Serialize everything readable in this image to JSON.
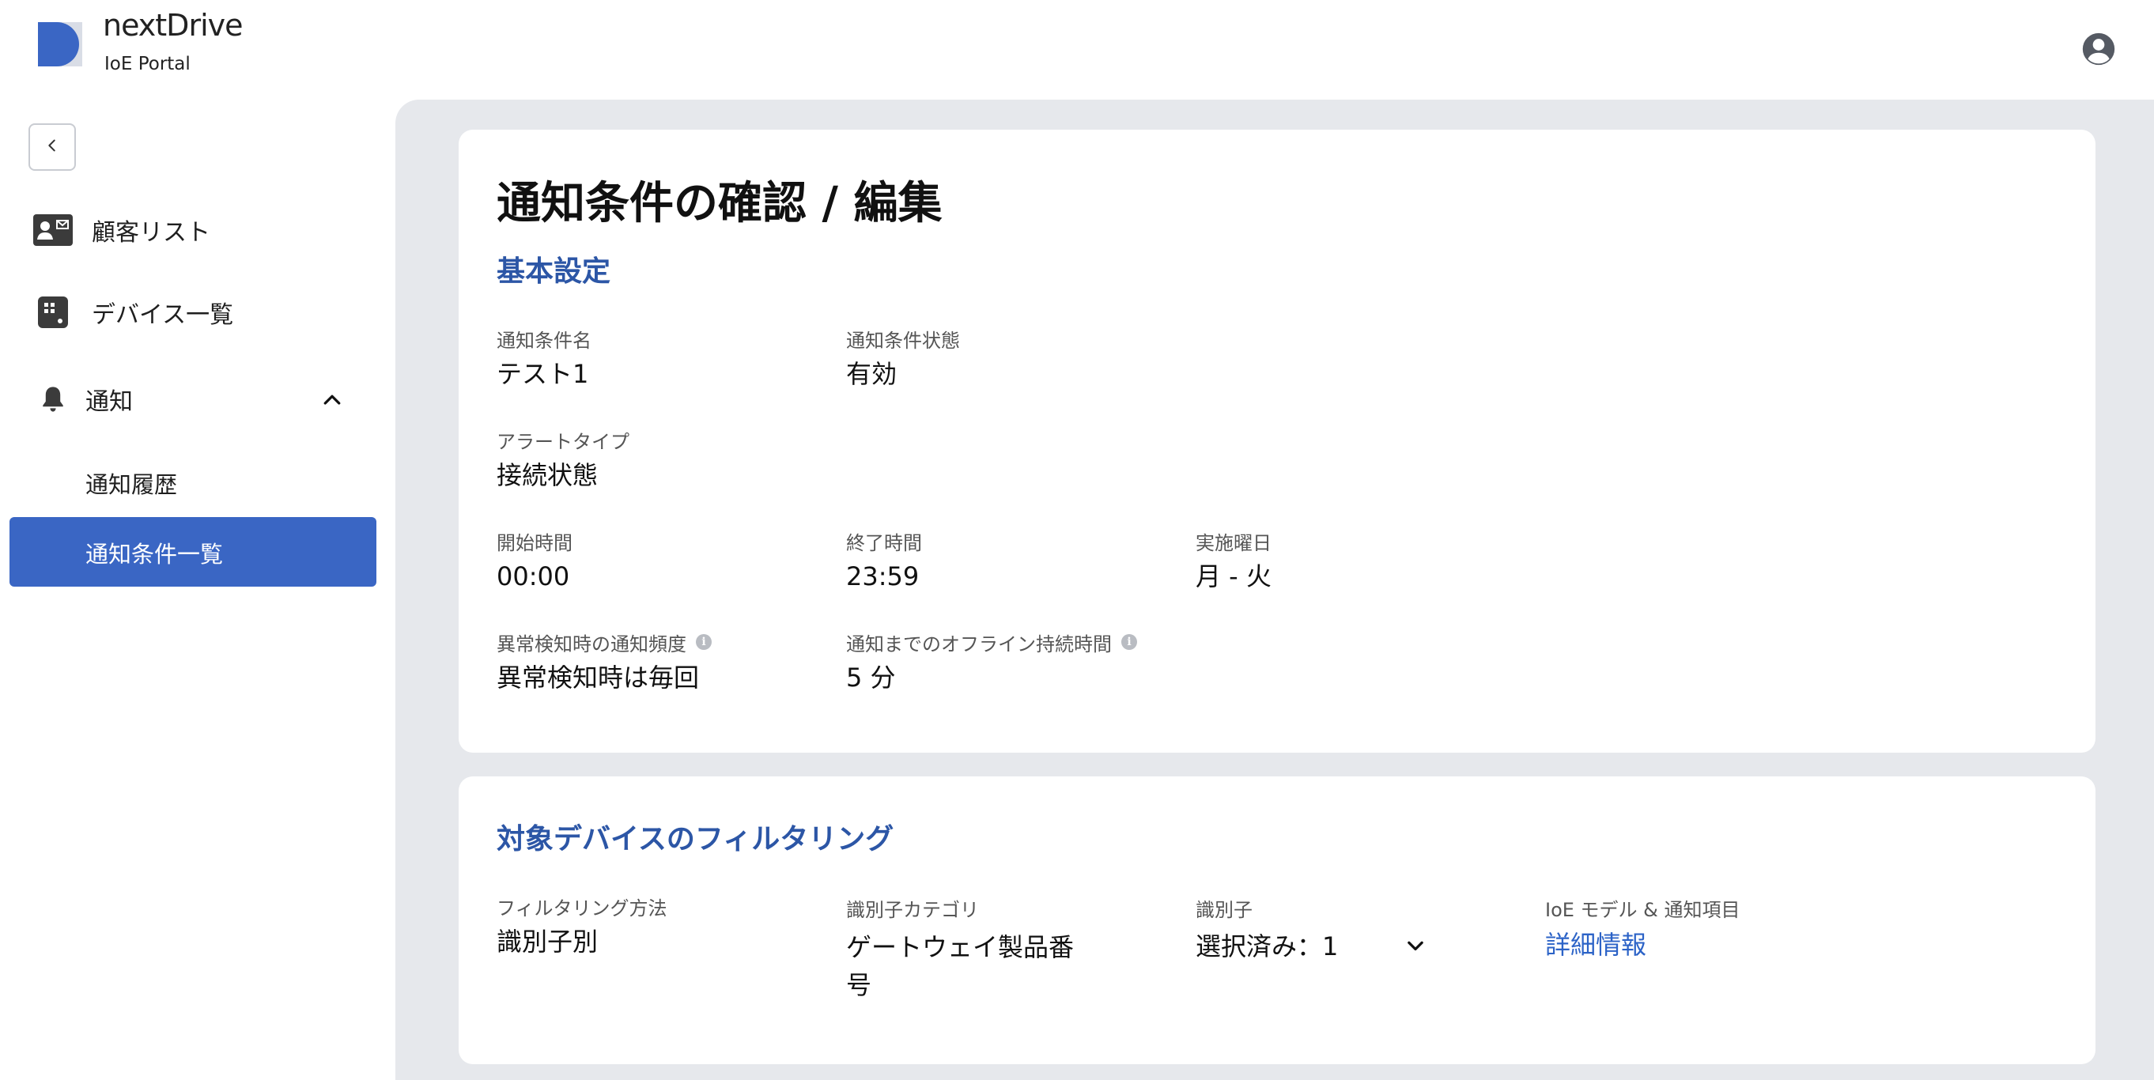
{
  "header": {
    "brand_name": "nextDrive",
    "brand_subtitle": "IoE Portal",
    "icons": {
      "logo": "nextdrive-logo",
      "account": "account-circle-icon"
    }
  },
  "sidebar": {
    "collapse_icon": "chevron-left-icon",
    "items": [
      {
        "label": "顧客リスト",
        "icon": "contact-card-icon"
      },
      {
        "label": "デバイス一覧",
        "icon": "device-icon"
      },
      {
        "label": "通知",
        "icon": "bell-icon",
        "expanded": true
      }
    ],
    "sub_items": [
      {
        "label": "通知履歴",
        "active": false
      },
      {
        "label": "通知条件一覧",
        "active": true
      }
    ]
  },
  "main": {
    "page_title": "通知条件の確認 / 編集",
    "basic": {
      "section_title": "基本設定",
      "fields": {
        "name": {
          "label": "通知条件名",
          "value": "テスト1"
        },
        "status": {
          "label": "通知条件状態",
          "value": "有効"
        },
        "alert_type": {
          "label": "アラートタイプ",
          "value": "接続状態"
        },
        "start_time": {
          "label": "開始時間",
          "value": "00:00"
        },
        "end_time": {
          "label": "終了時間",
          "value": "23:59"
        },
        "days": {
          "label": "実施曜日",
          "value": "月 - 火"
        },
        "frequency": {
          "label": "異常検知時の通知頻度",
          "value": "異常検知時は毎回"
        },
        "offline_duration": {
          "label": "通知までのオフライン持続時間",
          "value": "5 分"
        }
      }
    },
    "filtering": {
      "section_title": "対象デバイスのフィルタリング",
      "fields": {
        "method": {
          "label": "フィルタリング方法",
          "value": "識別子別"
        },
        "id_category": {
          "label": "識別子カテゴリ",
          "value": "ゲートウェイ製品番号"
        },
        "identifier": {
          "label": "識別子",
          "value": "選択済み：1"
        },
        "model_items": {
          "label": "IoE モデル & 通知項目",
          "value": "詳細情報"
        }
      }
    }
  },
  "colors": {
    "accent": "#3a66c4",
    "section_title": "#2c56a6",
    "link": "#2c63c7",
    "main_bg": "#e6e8ec"
  }
}
